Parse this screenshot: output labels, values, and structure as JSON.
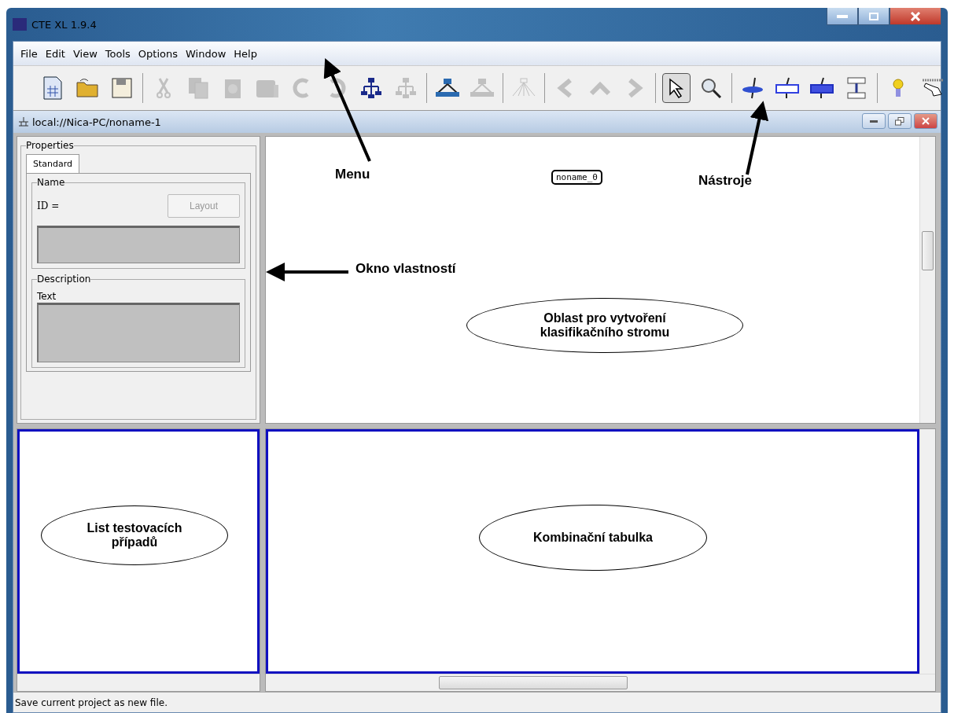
{
  "window": {
    "title": "CTE XL 1.9.4"
  },
  "menu": [
    "File",
    "Edit",
    "View",
    "Tools",
    "Options",
    "Window",
    "Help"
  ],
  "toolbar": [
    [
      {
        "kind": "new",
        "disabled": false
      },
      {
        "kind": "open",
        "disabled": false
      },
      {
        "kind": "save",
        "disabled": false
      }
    ],
    [
      {
        "kind": "cut",
        "disabled": true
      },
      {
        "kind": "copy",
        "disabled": true
      },
      {
        "kind": "paste",
        "disabled": true
      },
      {
        "kind": "delete",
        "disabled": true
      },
      {
        "kind": "undo",
        "disabled": true
      },
      {
        "kind": "redo",
        "disabled": true
      },
      {
        "kind": "tree",
        "disabled": false
      },
      {
        "kind": "tree",
        "disabled": true
      }
    ],
    [
      {
        "kind": "link",
        "disabled": false
      },
      {
        "kind": "link",
        "disabled": true
      }
    ],
    [
      {
        "kind": "fan",
        "disabled": true
      }
    ],
    [
      {
        "kind": "back",
        "disabled": true
      },
      {
        "kind": "up",
        "disabled": true
      },
      {
        "kind": "forward",
        "disabled": true
      }
    ],
    [
      {
        "kind": "select",
        "disabled": false,
        "selected": true
      },
      {
        "kind": "zoom",
        "disabled": false,
        "selected": false
      }
    ],
    [
      {
        "kind": "class",
        "disabled": false
      },
      {
        "kind": "classification",
        "disabled": false
      },
      {
        "kind": "classification-filled",
        "disabled": false
      },
      {
        "kind": "composition",
        "disabled": false
      }
    ],
    [
      {
        "kind": "hint",
        "disabled": false
      },
      {
        "kind": "hand",
        "disabled": false
      }
    ]
  ],
  "document": {
    "title": "local://Nica-PC/noname-1"
  },
  "properties": {
    "title": "Properties",
    "tabs": [
      {
        "label": "Standard",
        "selected": true
      }
    ],
    "name_group": "Name",
    "id_label": "ID =",
    "layout_button": "Layout",
    "description_group": "Description",
    "text_label": "Text"
  },
  "tree": {
    "root": "noname_0"
  },
  "annotations": {
    "menu": "Menu",
    "tools": "Nástroje",
    "properties": "Okno vlastností",
    "tree_area": "Oblast pro vytvoření klasifikačního stromu",
    "test_list": "List testovacích případů",
    "combination_table": "Kombinační tabulka"
  },
  "status_bar": "Save current project as new file."
}
